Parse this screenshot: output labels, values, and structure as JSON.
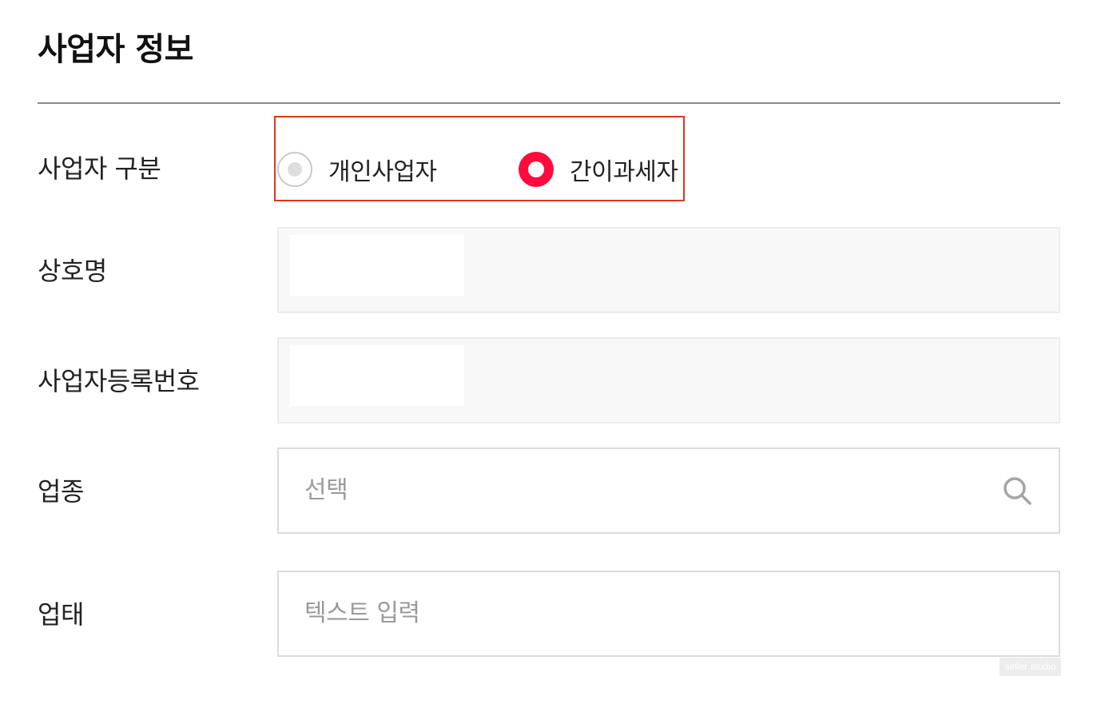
{
  "page": {
    "title": "사업자 정보"
  },
  "rows": {
    "business_type": {
      "label": "사업자 구분",
      "options": [
        {
          "label": "개인사업자",
          "selected": false
        },
        {
          "label": "간이과세자",
          "selected": true
        }
      ]
    },
    "company_name": {
      "label": "상호명",
      "value": ""
    },
    "registration_number": {
      "label": "사업자등록번호",
      "value": ""
    },
    "industry": {
      "label": "업종",
      "placeholder": "선택",
      "icon": "search-icon"
    },
    "business_category": {
      "label": "업태",
      "placeholder": "텍스트 입력"
    }
  },
  "watermark": "seller studio",
  "colors": {
    "accent": "#ff0b3e",
    "highlight_border": "#e5341b",
    "divider": "#8a8a8a",
    "placeholder": "#9a9a9a"
  }
}
